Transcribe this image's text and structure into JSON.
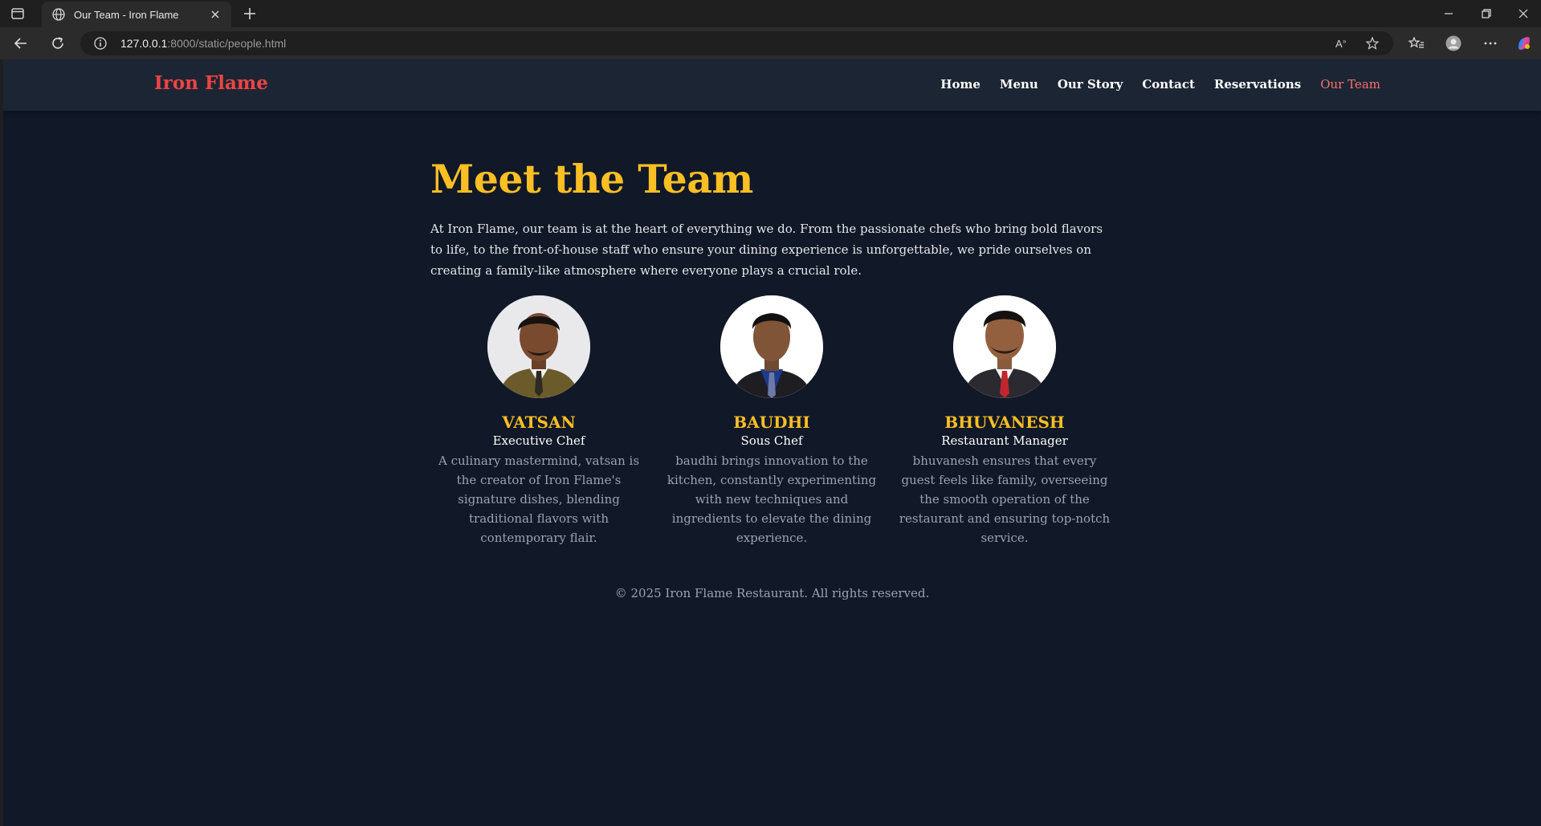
{
  "browser": {
    "tab_title": "Our Team - Iron Flame",
    "url_host": "127.0.0.1",
    "url_rest": ":8000/static/people.html"
  },
  "site": {
    "brand": "Iron Flame",
    "nav": [
      "Home",
      "Menu",
      "Our Story",
      "Contact",
      "Reservations",
      "Our Team"
    ],
    "active_nav": "Our Team"
  },
  "page": {
    "headline": "Meet the Team",
    "intro": "At Iron Flame, our team is at the heart of everything we do. From the passionate chefs who bring bold flavors to life, to the front-of-house staff who ensure your dining experience is unforgettable, we pride ourselves on creating a family-like atmosphere where everyone plays a crucial role."
  },
  "team": [
    {
      "name": "VATSAN",
      "role": "Executive Chef",
      "description": "A culinary mastermind, vatsan is the creator of Iron Flame's signature dishes, blending traditional flavors with contemporary flair."
    },
    {
      "name": "BAUDHI",
      "role": "Sous Chef",
      "description": "baudhi brings innovation to the kitchen, constantly experimenting with new techniques and ingredients to elevate the dining experience."
    },
    {
      "name": "BHUVANESH",
      "role": "Restaurant Manager",
      "description": "bhuvanesh ensures that every guest feels like family, overseeing the smooth operation of the restaurant and ensuring top-notch service."
    }
  ],
  "footer": "© 2025 Iron Flame Restaurant. All rights reserved.",
  "colors": {
    "page_bg": "#111827",
    "nav_bg": "#1c2533",
    "brand": "#ef4444",
    "accent": "#fbbf24",
    "muted_text": "#9ca3af"
  }
}
